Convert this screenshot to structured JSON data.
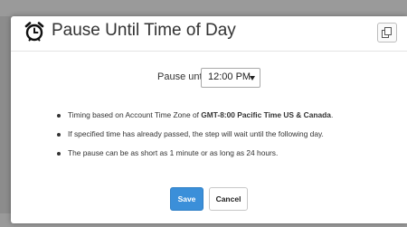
{
  "dialog": {
    "title": "Pause Until Time of Day",
    "icons": {
      "title_icon": "alarm-clock-icon",
      "header_button_icon": "copy-icon"
    }
  },
  "pause": {
    "label": "Pause until",
    "selected_time": "12:00 PM"
  },
  "notes": {
    "item1_prefix": "Timing based on Account Time Zone of ",
    "item1_bold": "GMT-8:00 Pacific Time US & Canada",
    "item1_suffix": ".",
    "item2": "If specified time has already passed, the step will wait until the following day.",
    "item3": "The pause can be as short as 1 minute or as long as 24 hours."
  },
  "buttons": {
    "save": "Save",
    "cancel": "Cancel"
  },
  "colors": {
    "primary": "#3b8fd9",
    "overlay": "#8c8c8c",
    "text": "#333333"
  }
}
